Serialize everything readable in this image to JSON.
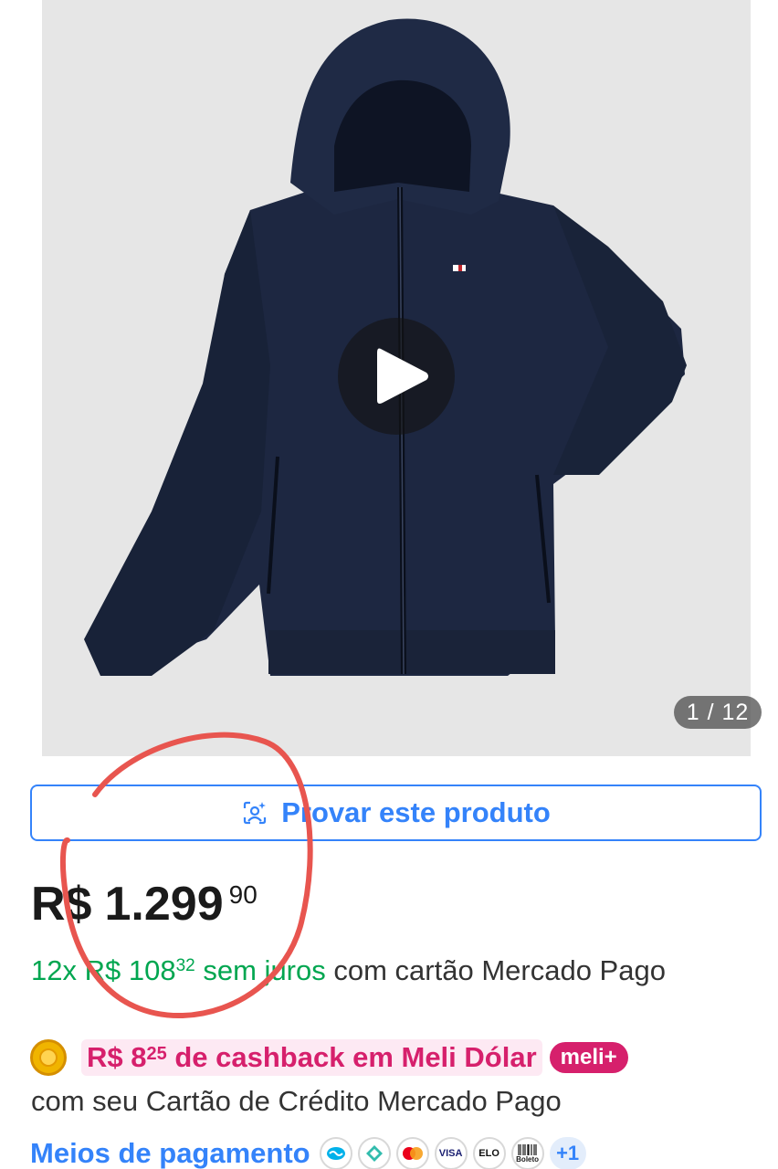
{
  "gallery": {
    "counter": "1 / 12",
    "play_icon": "play-icon"
  },
  "try_on": {
    "icon": "person-sparkle-icon",
    "label": "Provar este produto"
  },
  "price": {
    "currency": "R$",
    "amount": "1.299",
    "cents": "90"
  },
  "installments": {
    "count": "12x",
    "currency": "R$",
    "amount": "108",
    "cents": "32",
    "interest_free": "sem juros",
    "suffix": "com cartão Mercado Pago"
  },
  "cashback": {
    "coin_icon": "meli-dolar-coin-icon",
    "prefix": "R$ 8",
    "cents": "25",
    "suffix": "de cashback em Meli Dólar",
    "badge": "meli+",
    "subtext": "com seu Cartão de Crédito Mercado Pago"
  },
  "payments": {
    "link": "Meios de pagamento",
    "methods": [
      "mercado-pago-icon",
      "pix-icon",
      "mastercard-icon",
      "VISA",
      "ELO",
      "Boleto"
    ],
    "more": "+1"
  },
  "colors": {
    "accent_blue": "#3483fa",
    "green": "#00a650",
    "pink": "#d6206c",
    "annotation_red": "#e8554f"
  }
}
